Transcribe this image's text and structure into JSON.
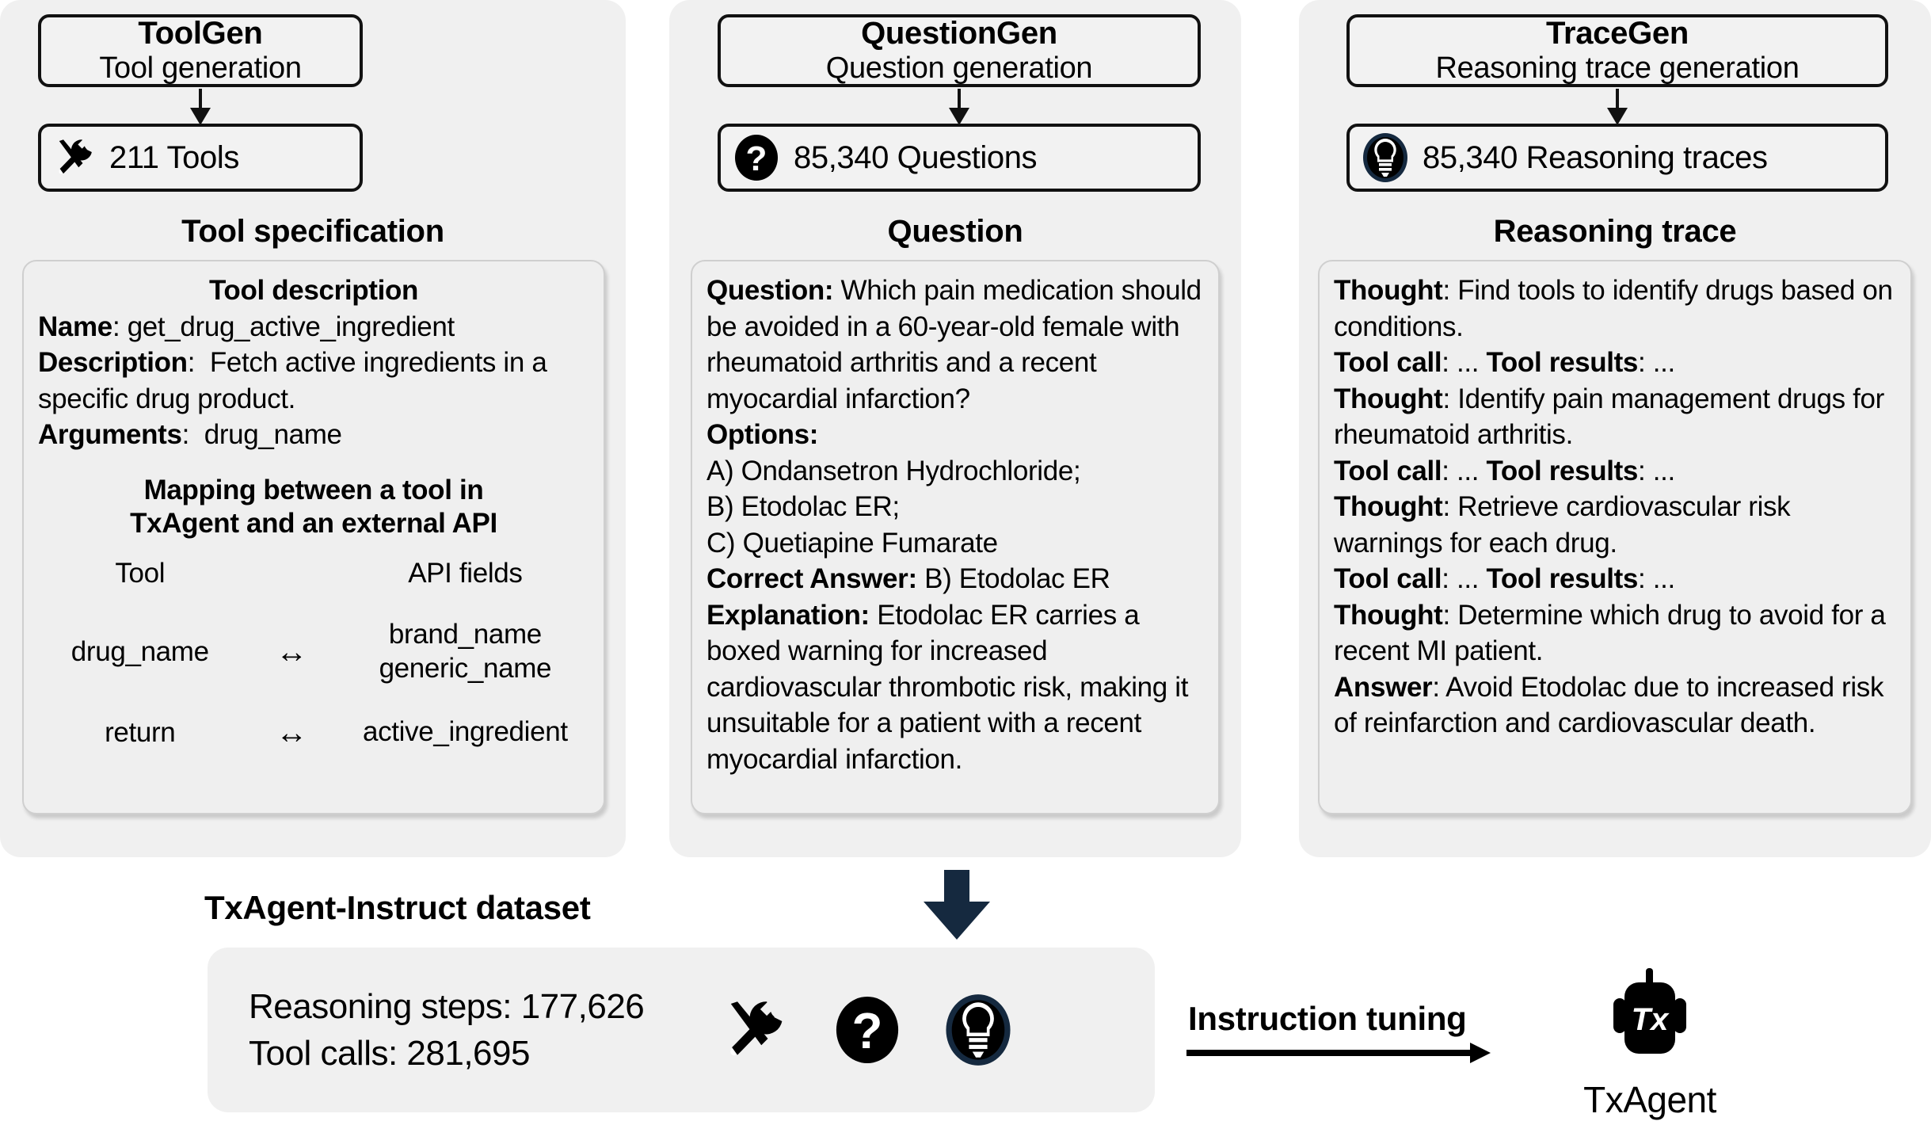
{
  "stages": [
    {
      "id": "toolgen",
      "title": "ToolGen",
      "subtitle": "Tool generation",
      "count_label": "211 Tools",
      "count_icon": "tools-icon",
      "section_heading": "Tool specification"
    },
    {
      "id": "questiongen",
      "title": "QuestionGen",
      "subtitle": "Question generation",
      "count_label": "85,340 Questions",
      "count_icon": "question-mark-icon",
      "section_heading": "Question"
    },
    {
      "id": "tracegen",
      "title": "TraceGen",
      "subtitle": "Reasoning trace generation",
      "count_label": "85,340 Reasoning traces",
      "count_icon": "lightbulb-icon",
      "section_heading": "Reasoning trace"
    }
  ],
  "tool_card": {
    "heading": "Tool description",
    "name_label": "Name",
    "name_value": "get_drug_active_ingredient",
    "description_label": "Description",
    "description_value": "Fetch active ingredients in a specific drug product.",
    "arguments_label": "Arguments",
    "arguments_value": "drug_name",
    "mapping_heading_line1": "Mapping between a tool in",
    "mapping_heading_line2": "TxAgent and an external API",
    "col_tool_header": "Tool",
    "col_api_header": "API fields",
    "rows": [
      {
        "tool": "drug_name",
        "mapping": "↔",
        "api_line1": "brand_name",
        "api_line2": "generic_name"
      },
      {
        "tool": "return",
        "mapping": "↔",
        "api_line1": "active_ingredient",
        "api_line2": ""
      }
    ]
  },
  "question_card": {
    "question_label": "Question:",
    "question_text": " Which pain medication should be avoided in a 60-year-old female with rheumatoid arthritis and a recent myocardial infarction?",
    "options_label": "Options:",
    "options": [
      "A) Ondansetron Hydrochloride;",
      "B) Etodolac ER;",
      "C) Quetiapine Fumarate"
    ],
    "answer_label": "Correct Answer:",
    "answer_text": " B) Etodolac ER",
    "explanation_label": "Explanation:",
    "explanation_text": " Etodolac ER carries a boxed warning for increased cardiovascular thrombotic risk, making it unsuitable for a patient with a recent myocardial infarction."
  },
  "trace_card": {
    "lines": [
      {
        "label": "Thought",
        "sep": ": ",
        "text": "Find tools to identify drugs based on conditions."
      },
      {
        "label": "Tool call",
        "sep": ": ",
        "text": "... ",
        "label2": "Tool results",
        "sep2": ": ",
        "text2": "..."
      },
      {
        "label": "Thought",
        "sep": ": ",
        "text": "Identify pain management drugs for rheumatoid arthritis."
      },
      {
        "label": "Tool call",
        "sep": ": ",
        "text": "... ",
        "label2": "Tool results",
        "sep2": ": ",
        "text2": "..."
      },
      {
        "label": "Thought",
        "sep": ": ",
        "text": "Retrieve cardiovascular risk warnings for each drug."
      },
      {
        "label": "Tool call",
        "sep": ": ",
        "text": "... ",
        "label2": "Tool results",
        "sep2": ": ",
        "text2": "..."
      },
      {
        "label": "Thought",
        "sep": ": ",
        "text": "Determine which drug to avoid for a recent MI patient."
      },
      {
        "label": "Answer",
        "sep": ": ",
        "text": "Avoid Etodolac due to increased risk of reinfarction and cardiovascular death."
      }
    ]
  },
  "bottom": {
    "dataset_heading": "TxAgent-Instruct dataset",
    "stat_reasoning": "Reasoning steps: 177,626",
    "stat_toolcalls": "Tool calls: 281,695",
    "icons": [
      "tools-icon",
      "question-mark-icon",
      "lightbulb-icon"
    ],
    "tuning_label": "Instruction tuning",
    "agent_label": "TxAgent",
    "agent_badge": "Tx"
  },
  "colors": {
    "panel_bg": "#f0f0f0",
    "card_bg": "#efefef",
    "card_border": "#cfcfcf",
    "outline": "#111111",
    "arrow_navy": "#15293f",
    "text": "#000000"
  }
}
